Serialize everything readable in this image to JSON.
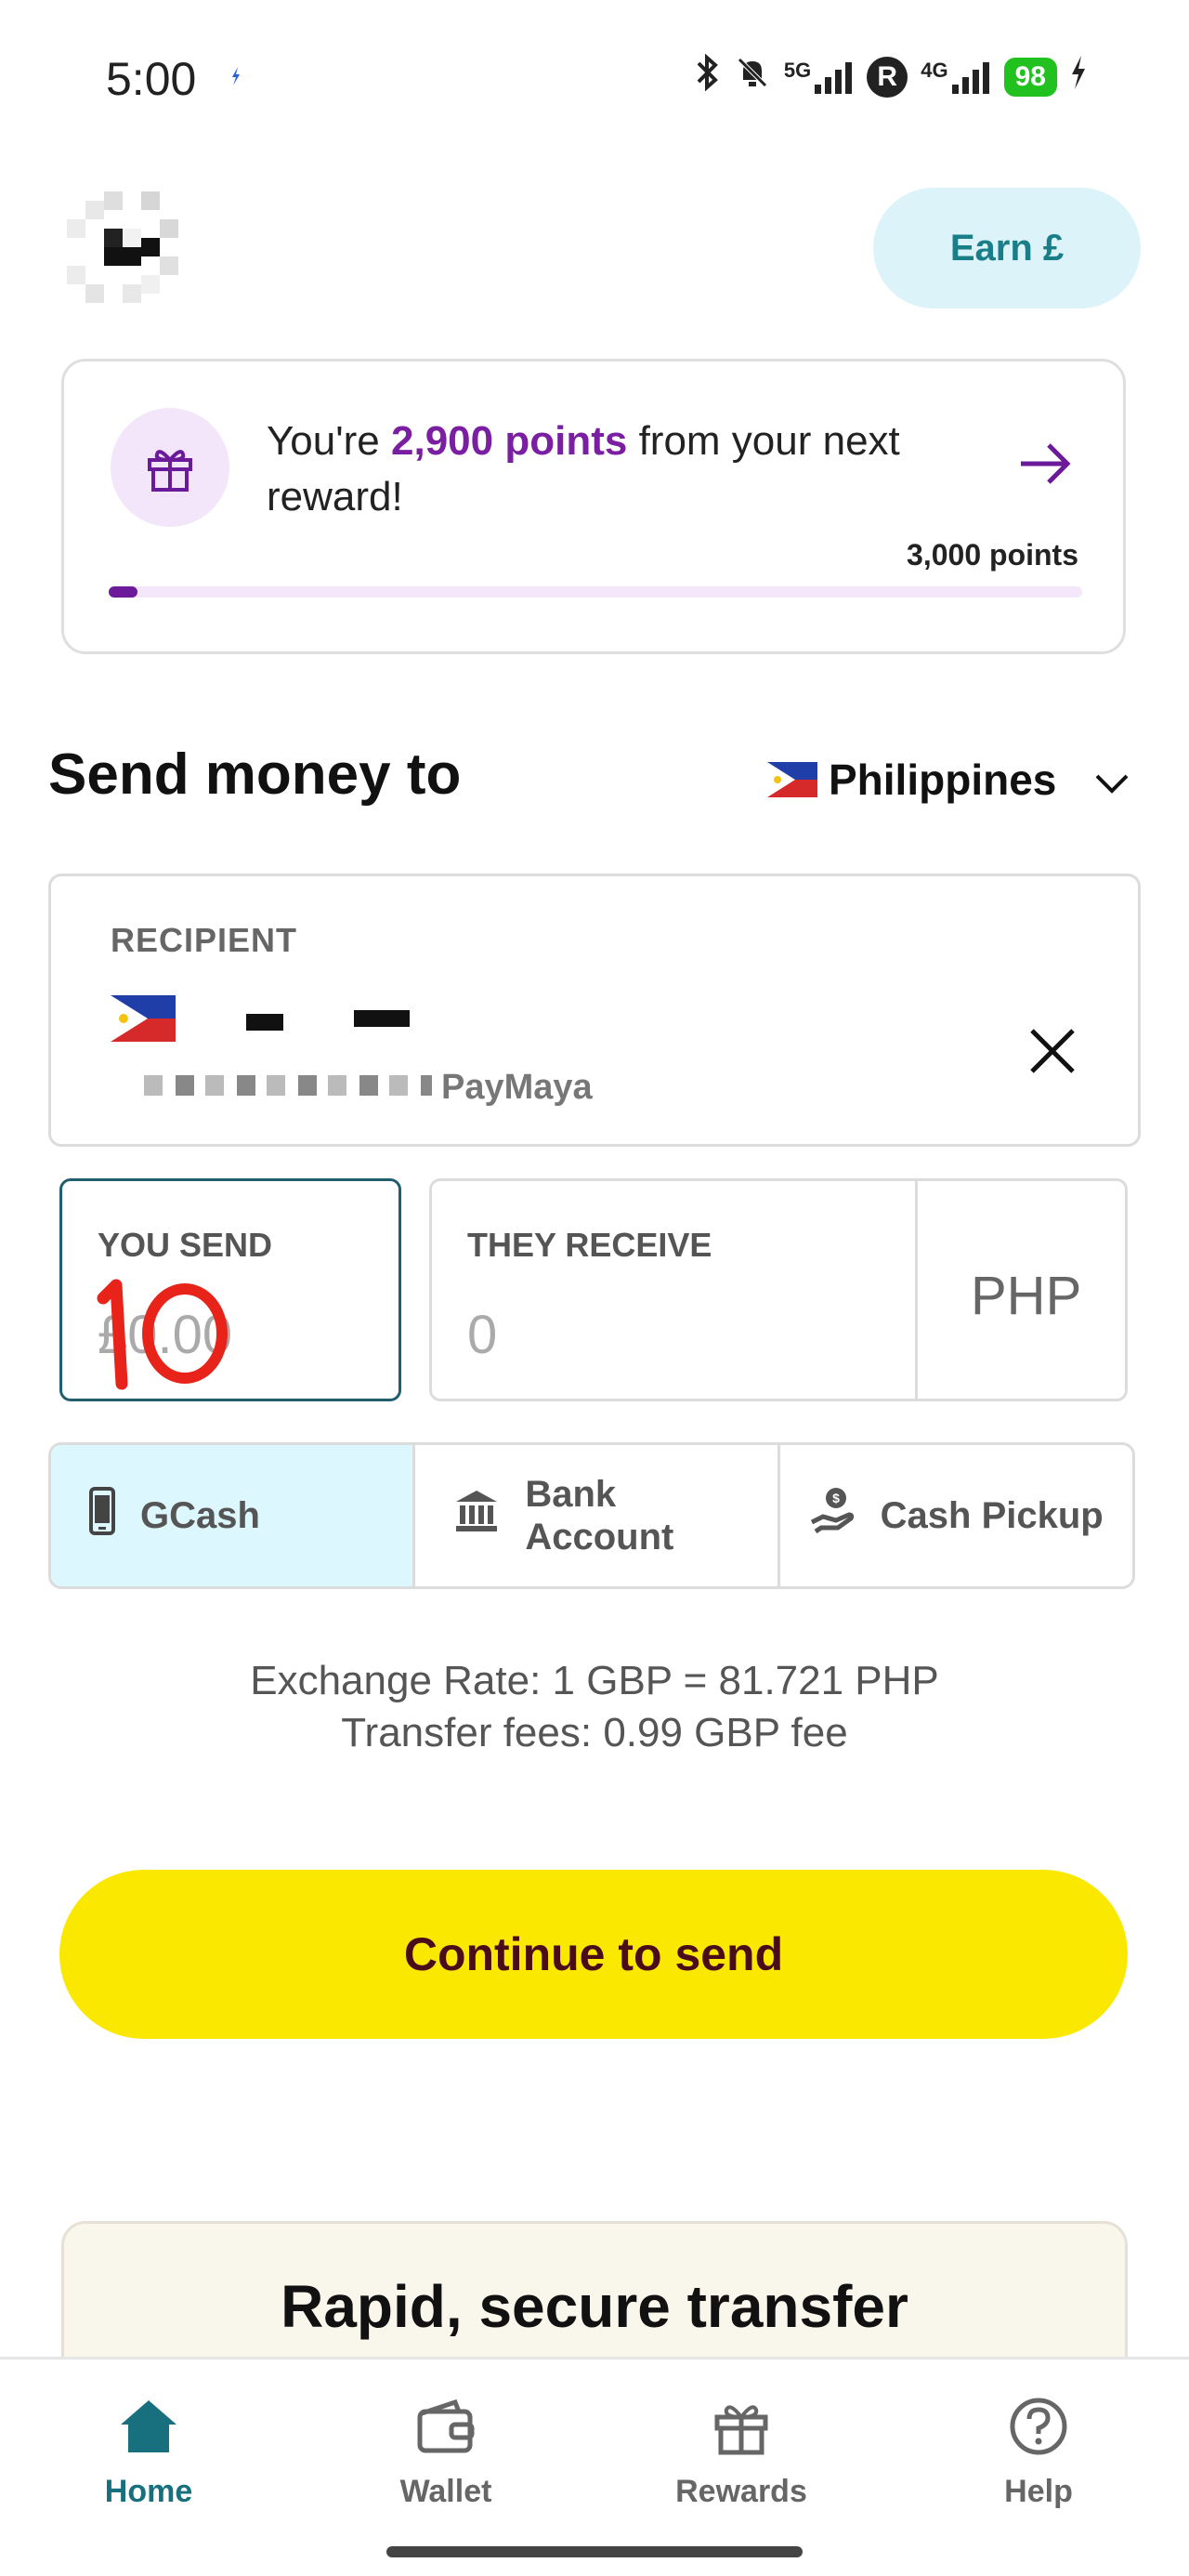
{
  "status_bar": {
    "time": "5:00",
    "network_1": "5G",
    "network_2": "4G",
    "battery": "98"
  },
  "header": {
    "earn_button": "Earn £"
  },
  "rewards": {
    "text_prefix": "You're",
    "points_highlight": "2,900 points",
    "text_suffix": "from your next reward!",
    "goal": "3,000 points",
    "progress_percent": 3
  },
  "send_section": {
    "title": "Send money to",
    "country": "Philippines"
  },
  "recipient": {
    "label": "RECIPIENT",
    "provider_suffix": "PayMaya"
  },
  "amounts": {
    "you_send_label": "YOU SEND",
    "you_send_placeholder": "£0.00",
    "they_receive_label": "THEY RECEIVE",
    "they_receive_value": "0",
    "currency": "PHP",
    "handwritten_annotation": "10"
  },
  "methods": [
    {
      "label": "GCash",
      "icon": "phone-icon",
      "active": true
    },
    {
      "label": "Bank Account",
      "icon": "bank-icon",
      "active": false
    },
    {
      "label": "Cash Pickup",
      "icon": "cash-hand-icon",
      "active": false
    }
  ],
  "rates": {
    "exchange": "Exchange Rate: 1 GBP = 81.721 PHP",
    "fees": "Transfer fees: 0.99 GBP fee"
  },
  "cta": {
    "continue": "Continue to send"
  },
  "promo": {
    "title": "Rapid, secure transfer"
  },
  "nav": [
    {
      "label": "Home",
      "active": true
    },
    {
      "label": "Wallet",
      "active": false
    },
    {
      "label": "Rewards",
      "active": false
    },
    {
      "label": "Help",
      "active": false
    }
  ],
  "colors": {
    "accent_teal": "#18707e",
    "cta_yellow": "#fbe800",
    "reward_purple": "#7a1fa2",
    "method_active_bg": "#dcf7fd"
  }
}
